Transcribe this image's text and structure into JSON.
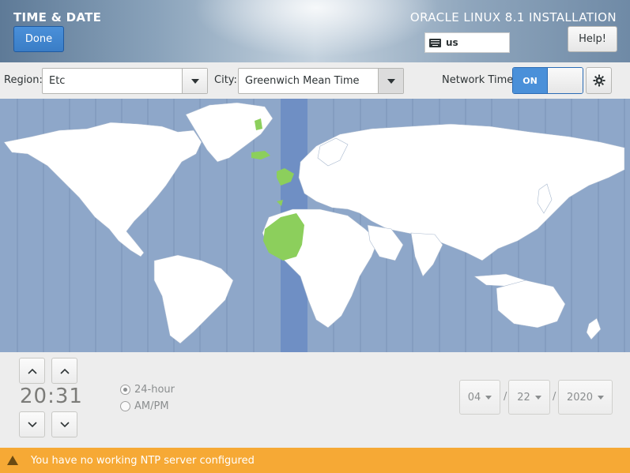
{
  "header": {
    "title": "TIME & DATE",
    "done_label": "Done",
    "product": "ORACLE LINUX 8.1 INSTALLATION",
    "keyboard_layout": "us",
    "help_label": "Help!"
  },
  "timezone": {
    "region_label": "Region:",
    "region_value": "Etc",
    "city_label": "City:",
    "city_value": "Greenwich Mean Time",
    "network_time_label": "Network Time",
    "network_time_state": "ON"
  },
  "clock": {
    "hours": "20",
    "minutes": "31",
    "separator": ":",
    "format_24_label": "24-hour",
    "format_ampm_label": "AM/PM",
    "selected_format": "24-hour"
  },
  "date": {
    "month": "04",
    "day": "22",
    "year": "2020",
    "separator": "/"
  },
  "warning": {
    "text": "You have no working NTP server configured"
  },
  "colors": {
    "accent": "#4a90d9",
    "ocean": "#8ea7c9",
    "selected_zone": "#6f8fc4",
    "selected_land": "#8ccf5c",
    "warning_bar": "#f6a935"
  }
}
